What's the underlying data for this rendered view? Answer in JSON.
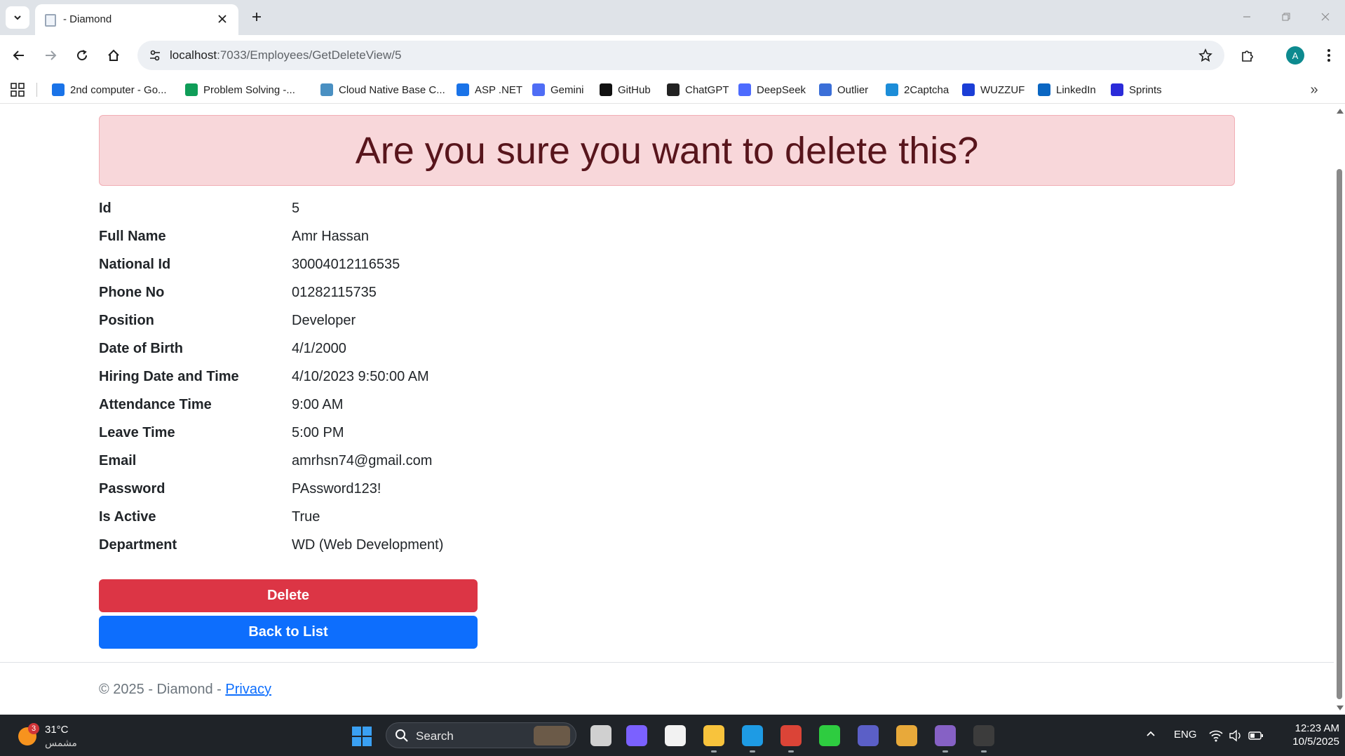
{
  "browser": {
    "tab_title": "- Diamond",
    "url_host": "localhost",
    "url_path": ":7033/Employees/GetDeleteView/5",
    "profile_initial": "A",
    "bookmarks": [
      {
        "label": "2nd computer - Go...",
        "icon": "google-drive-icon",
        "color": "#1a73e8"
      },
      {
        "label": "Problem Solving -...",
        "icon": "google-sheets-icon",
        "color": "#0f9d58"
      },
      {
        "label": "Cloud Native Base C...",
        "icon": "cloud-icon",
        "color": "#4a90c2"
      },
      {
        "label": "ASP .NET",
        "icon": "google-drive-icon",
        "color": "#1a73e8"
      },
      {
        "label": "Gemini",
        "icon": "gemini-icon",
        "color": "#4f6df5"
      },
      {
        "label": "GitHub",
        "icon": "github-icon",
        "color": "#111111"
      },
      {
        "label": "ChatGPT",
        "icon": "chatgpt-icon",
        "color": "#222222"
      },
      {
        "label": "DeepSeek",
        "icon": "deepseek-icon",
        "color": "#4d6bfe"
      },
      {
        "label": "Outlier",
        "icon": "outlier-icon",
        "color": "#3b6fd8"
      },
      {
        "label": "2Captcha",
        "icon": "2captcha-icon",
        "color": "#1c8dd8"
      },
      {
        "label": "WUZZUF",
        "icon": "wuzzuf-icon",
        "color": "#1b3ed6"
      },
      {
        "label": "LinkedIn",
        "icon": "linkedin-icon",
        "color": "#0a66c2"
      },
      {
        "label": "Sprints",
        "icon": "sprints-icon",
        "color": "#2b2bd9"
      }
    ]
  },
  "page": {
    "heading": "Are you sure you want to delete this?",
    "fields": [
      {
        "label": "Id",
        "value": "5"
      },
      {
        "label": "Full Name",
        "value": "Amr Hassan"
      },
      {
        "label": "National Id",
        "value": "30004012116535"
      },
      {
        "label": "Phone No",
        "value": "01282115735"
      },
      {
        "label": "Position",
        "value": "Developer"
      },
      {
        "label": "Date of Birth",
        "value": "4/1/2000"
      },
      {
        "label": "Hiring Date and Time",
        "value": "4/10/2023 9:50:00 AM"
      },
      {
        "label": "Attendance Time",
        "value": "9:00 AM"
      },
      {
        "label": "Leave Time",
        "value": "5:00 PM"
      },
      {
        "label": "Email",
        "value": "amrhsn74@gmail.com"
      },
      {
        "label": "Password",
        "value": "PAssword123!"
      },
      {
        "label": "Is Active",
        "value": "True"
      },
      {
        "label": "Department",
        "value": "WD (Web Development)"
      }
    ],
    "delete_label": "Delete",
    "back_label": "Back to List",
    "footer_text": "© 2025 - Diamond - ",
    "footer_link": "Privacy"
  },
  "taskbar": {
    "weather_badge": "3",
    "weather_temp": "31°C",
    "weather_cond": "مشمس",
    "search_placeholder": "Search",
    "language": "ENG",
    "time": "12:23 AM",
    "date": "10/5/2025",
    "apps": [
      {
        "name": "task-view",
        "color": "#d0d0d0"
      },
      {
        "name": "copilot",
        "color": "#7b61ff"
      },
      {
        "name": "microsoft-store",
        "color": "#f2f2f2"
      },
      {
        "name": "file-explorer",
        "color": "#f8c33c"
      },
      {
        "name": "edge",
        "color": "#1e9be4"
      },
      {
        "name": "chrome",
        "color": "#db4437"
      },
      {
        "name": "obs",
        "color": "#2ecc40"
      },
      {
        "name": "teams",
        "color": "#5b5fc7"
      },
      {
        "name": "snipping-tool",
        "color": "#e8a93a"
      },
      {
        "name": "visual-studio",
        "color": "#8661c5"
      },
      {
        "name": "terminal",
        "color": "#3c3c3c"
      }
    ]
  }
}
